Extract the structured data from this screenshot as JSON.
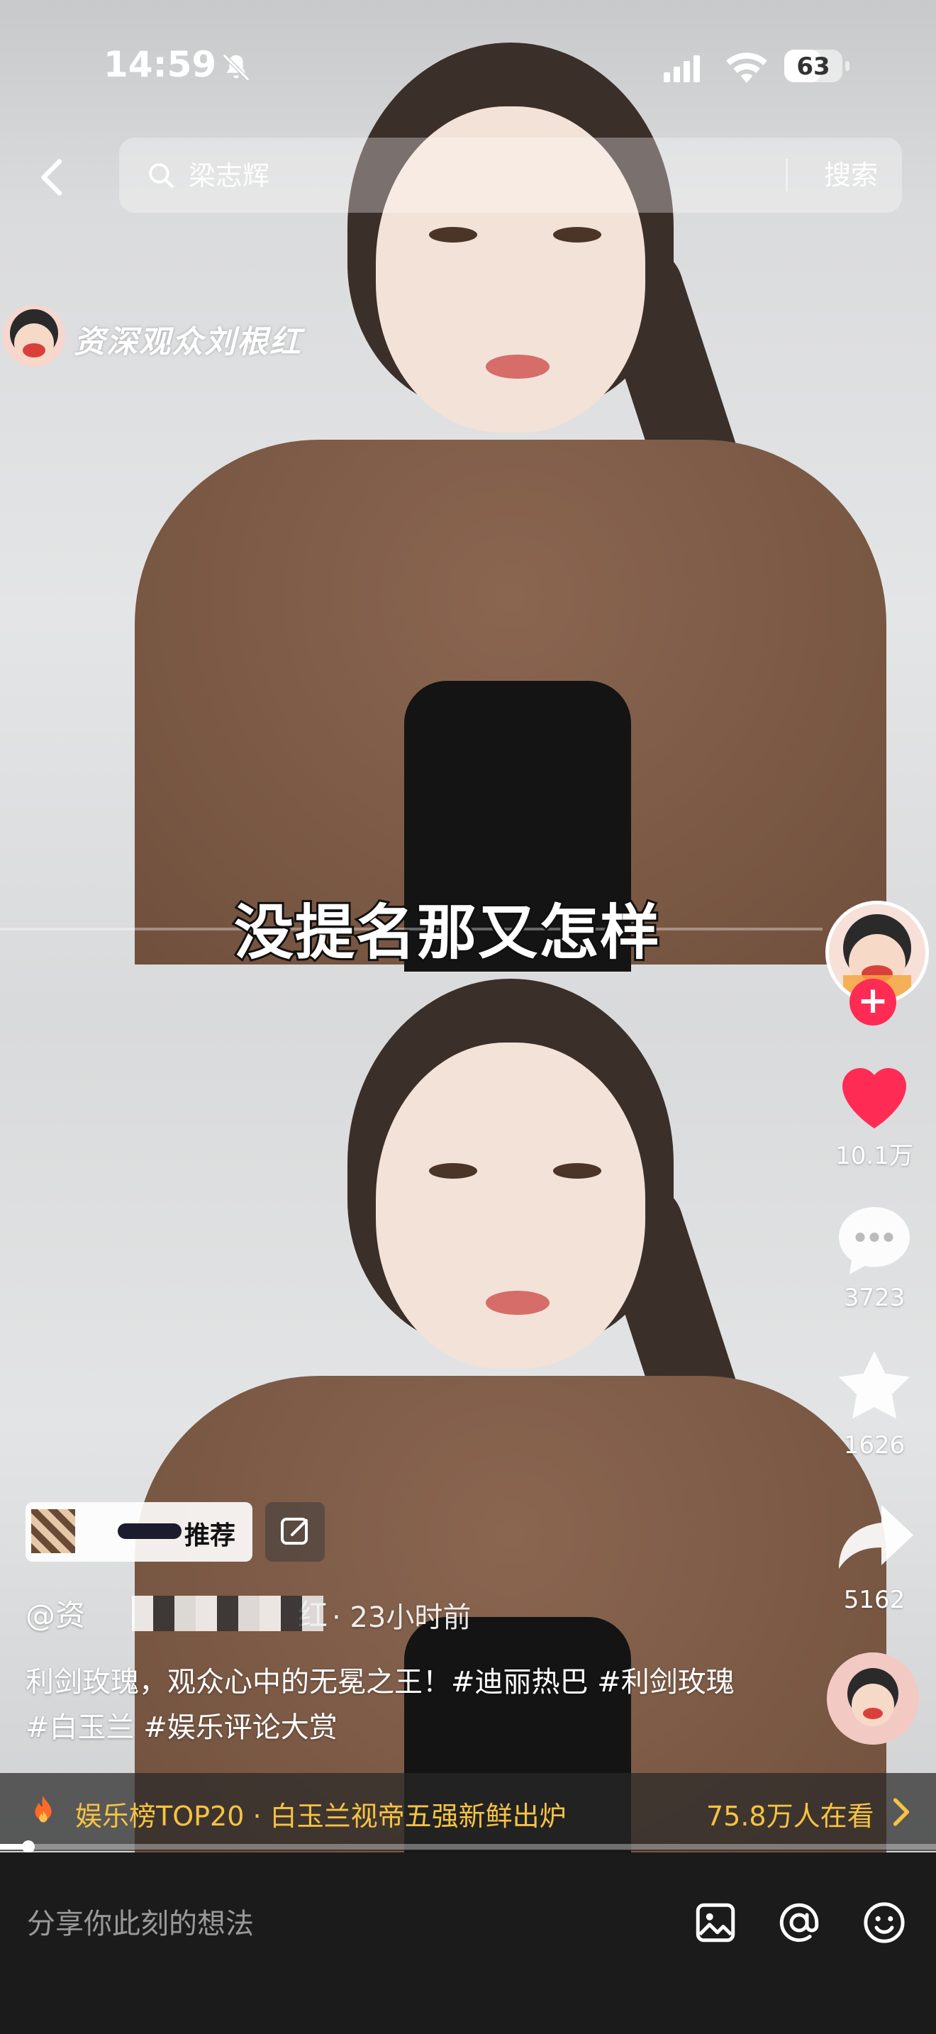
{
  "status_bar": {
    "time": "14:59",
    "battery_level": "63"
  },
  "search": {
    "placeholder": "梁志辉",
    "button_label": "搜索"
  },
  "watermark": {
    "text": "资深观众刘根红"
  },
  "video": {
    "caption": "没提名那又怎样"
  },
  "actions": {
    "likes": "10.1万",
    "comments": "3723",
    "favorites": "1626",
    "shares": "5162"
  },
  "post": {
    "recommend_label": "推荐",
    "author_prefix": "@资",
    "author_suffix": "红",
    "time_ago": "· 23小时前",
    "description": "利剑玫瑰，观众心中的无冕之王！#迪丽热巴 #利剑玫瑰 #白玉兰 #娱乐评论大赏"
  },
  "hot_banner": {
    "text": "娱乐榜TOP20 · 白玉兰视帝五强新鲜出炉",
    "watching": "75.8万人在看"
  },
  "playback": {
    "progress_fraction": 0.03
  },
  "comment_bar": {
    "placeholder": "分享你此刻的想法"
  },
  "colors": {
    "accent_red": "#fe2c55",
    "hot_yellow": "#f6c343",
    "bar_bg": "#1b1b1b"
  }
}
